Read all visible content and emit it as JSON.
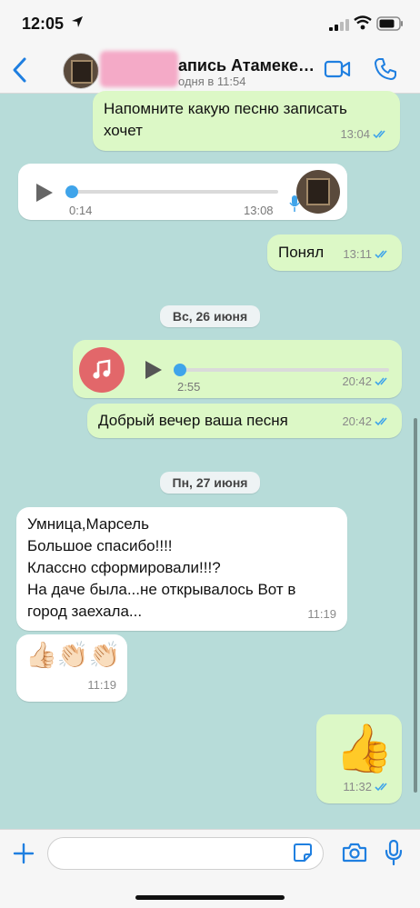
{
  "status_bar": {
    "time": "12:05"
  },
  "header": {
    "contact_name": "апись Атамеке…",
    "contact_status": "одня в 11:54",
    "icons": [
      "back-chevron-icon",
      "video-call-icon",
      "phone-call-icon"
    ]
  },
  "messages": [
    {
      "text_lines": [
        "Напомните какую песню записать",
        "хочет"
      ],
      "time": "13:04"
    },
    {
      "voice_elapsed": "0:14",
      "time": "13:08"
    },
    {
      "text": "Понял",
      "time": "13:11"
    },
    {
      "date": "Вс, 26 июня"
    },
    {
      "audio_duration": "2:55",
      "time": "20:42"
    },
    {
      "text": "Добрый вечер ваша песня",
      "time": "20:42"
    },
    {
      "date": "Пн, 27 июня"
    },
    {
      "text_lines": [
        "Умница,Марсель",
        "Большое спасибо!!!!",
        "Классно сформировали!!!?",
        "На даче была...не открывалось Вот в",
        "город заехала..."
      ],
      "time": "11:19"
    },
    {
      "emoji": "👍🏻👏🏻👏🏻",
      "time": "11:19"
    },
    {
      "emoji": "👍",
      "time": "11:32"
    }
  ],
  "input": {
    "placeholder": ""
  },
  "colors": {
    "outgoing": "#dcf8c6",
    "incoming": "#ffffff",
    "accent": "#1f7fe0",
    "chat_bg": "#b7dcd9"
  }
}
